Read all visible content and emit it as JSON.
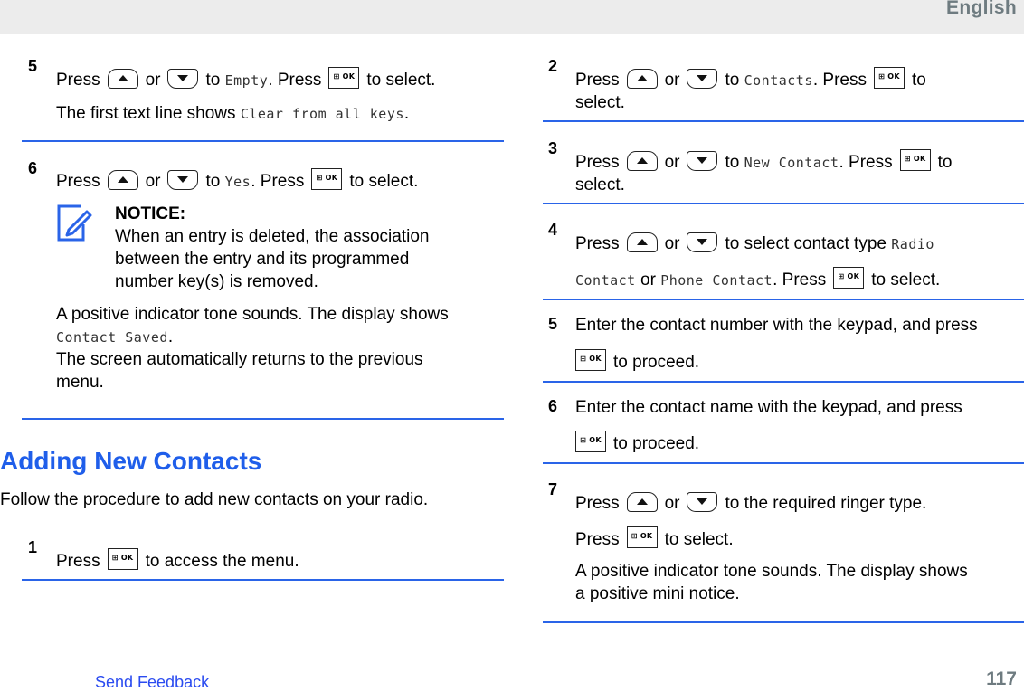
{
  "header": {
    "language": "English"
  },
  "left_column": {
    "step5": {
      "number": "5",
      "press": "Press",
      "or": "or",
      "to": "to",
      "target": "Empty",
      "press2": ". Press",
      "select": "to select.",
      "line2_prefix": "The first text line shows",
      "line2_mono": "Clear from all keys",
      "line2_suffix": "."
    },
    "step6": {
      "number": "6",
      "press": "Press",
      "or": "or",
      "to": "to",
      "target": "Yes",
      "press2": ". Press",
      "select": "to select.",
      "notice_title": "NOTICE:",
      "notice_lines": [
        "When an entry is deleted, the association",
        "between the entry and its programmed",
        "number key(s) is removed."
      ],
      "result_line1": "A positive indicator tone sounds. The display shows",
      "result_mono": "Contact Saved",
      "result_mono_suffix": ".",
      "result_line3": "The screen automatically returns to the previous",
      "result_line4": "menu."
    },
    "section": {
      "title": "Adding New Contacts",
      "intro": "Follow the procedure to add new contacts on your radio."
    },
    "step1": {
      "number": "1",
      "press": "Press",
      "rest": "to access the menu."
    }
  },
  "right_column": {
    "step2": {
      "number": "2",
      "press": "Press",
      "or": "or",
      "to": "to",
      "target": "Contacts",
      "press2": ". Press",
      "to_end": "to",
      "line2": "select."
    },
    "step3": {
      "number": "3",
      "press": "Press",
      "or": "or",
      "to": "to",
      "target": "New Contact",
      "press2": ". Press",
      "to_end": "to",
      "line2": "select."
    },
    "step4": {
      "number": "4",
      "press": "Press",
      "or": "or",
      "text": "to select contact type",
      "mono1": "Radio",
      "mono2": "Contact",
      "or2": "or",
      "mono3": "Phone Contact",
      "press2": ". Press",
      "select": "to select."
    },
    "step5": {
      "number": "5",
      "line1": "Enter the contact number with the keypad, and press",
      "line2": "to proceed."
    },
    "step6": {
      "number": "6",
      "line1": "Enter the contact name with the keypad, and press",
      "line2": "to proceed."
    },
    "step7": {
      "number": "7",
      "press": "Press",
      "or": "or",
      "text": "to the required ringer type.",
      "press2": "Press",
      "select": "to select.",
      "result1": "A positive indicator tone sounds. The display shows",
      "result2": "a positive mini notice."
    }
  },
  "keys": {
    "ok_label": "OK",
    "ok_grid": "⊞"
  },
  "footer": {
    "feedback_link": "Send Feedback",
    "page_number": "117"
  }
}
